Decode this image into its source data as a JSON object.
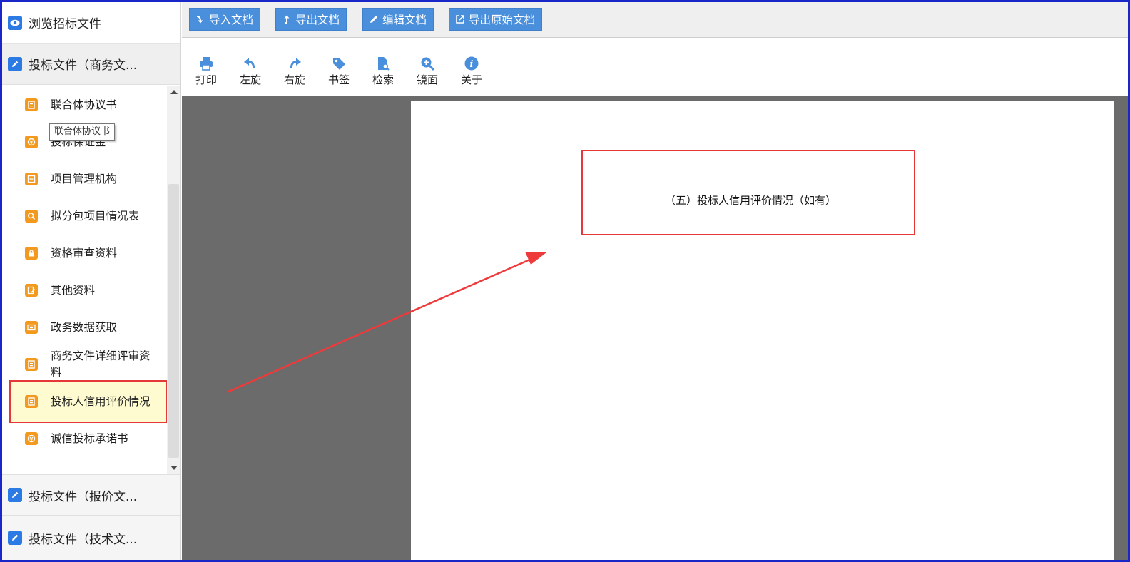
{
  "sidebar": {
    "sections": [
      {
        "label": "浏览招标文件",
        "icon": "eye-icon"
      },
      {
        "label": "投标文件（商务文...",
        "icon": "edit-icon"
      },
      {
        "label": "投标文件（报价文...",
        "icon": "edit-icon"
      },
      {
        "label": "投标文件（技术文...",
        "icon": "edit-icon"
      }
    ],
    "items": [
      {
        "label": "联合体协议书",
        "icon": "document-icon"
      },
      {
        "label": "投标保证金",
        "icon": "money-icon"
      },
      {
        "label": "项目管理机构",
        "icon": "list-icon"
      },
      {
        "label": "拟分包项目情况表",
        "icon": "search-icon"
      },
      {
        "label": "资格审查资料",
        "icon": "lock-icon"
      },
      {
        "label": "其他资料",
        "icon": "note-icon"
      },
      {
        "label": "政务数据获取",
        "icon": "ticket-icon"
      },
      {
        "label": "商务文件详细评审资料",
        "icon": "document-icon"
      },
      {
        "label": "投标人信用评价情况",
        "icon": "document-icon"
      },
      {
        "label": "诚信投标承诺书",
        "icon": "money-icon"
      }
    ],
    "tooltip": "联合体协议书",
    "active_item": "投标人信用评价情况"
  },
  "toolbar": {
    "import": "导入文档",
    "export": "导出文档",
    "edit": "编辑文档",
    "export_original": "导出原始文档"
  },
  "viewer_tools": {
    "print": "打印",
    "rotate_left": "左旋",
    "rotate_right": "右旋",
    "bookmark": "书签",
    "search": "检索",
    "mirror": "镜面",
    "about": "关于"
  },
  "document": {
    "text": "（五）投标人信用评价情况（如有）"
  },
  "colors": {
    "accent": "#4a8fdc",
    "item_icon": "#f39a1e",
    "highlight": "#e53939",
    "frame": "#1a27c8",
    "active_bg": "#fffbd0"
  }
}
